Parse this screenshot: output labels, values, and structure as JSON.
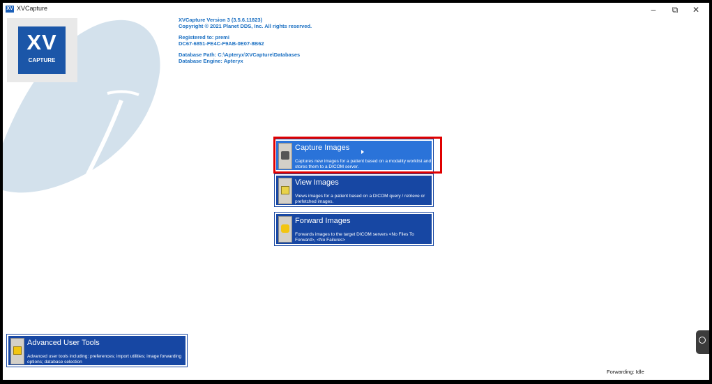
{
  "window": {
    "icon_text": "XV",
    "title": "XVCapture",
    "minimize": "–",
    "restore": "⧉",
    "close": "✕"
  },
  "logo": {
    "main": "XV",
    "sub": "CAPTURE"
  },
  "info": {
    "version": "XVCapture Version 3 (3.5.6.11823)",
    "copyright": "Copyright © 2021 Planet DDS, Inc. All rights reserved.",
    "registered_to": "Registered to: premi",
    "license_key": "DC67-6851-FE4C-F9AB-0E07-8B62",
    "db_path": "Database Path: C:\\Apteryx\\XVCapture\\Databases",
    "db_engine": "Database Engine: Apteryx"
  },
  "actions": [
    {
      "title": "Capture Images",
      "description": "Captures new images for a patient based on a modality worklist and stores them to a DICOM server.",
      "icon": "camera-icon"
    },
    {
      "title": "View Images",
      "description": "Views images for a patient based on a DICOM query / retrieve or prefetched images.",
      "icon": "picture-icon"
    },
    {
      "title": "Forward Images",
      "description": "Forwards images to the target DICOM servers <No Files To Forward>, <No Failures>",
      "icon": "database-forward-icon"
    }
  ],
  "advanced": {
    "title": "Advanced User Tools",
    "description": "Advanced user tools including: preferences; import utilities; image forwarding options; database selection",
    "icon": "tools-icon"
  },
  "status": {
    "forwarding": "Forwarding: Idle"
  },
  "colors": {
    "tile_blue": "#1747a3",
    "tile_active": "#2a73d9",
    "info_text": "#1a6fc2",
    "highlight": "#e00000"
  }
}
